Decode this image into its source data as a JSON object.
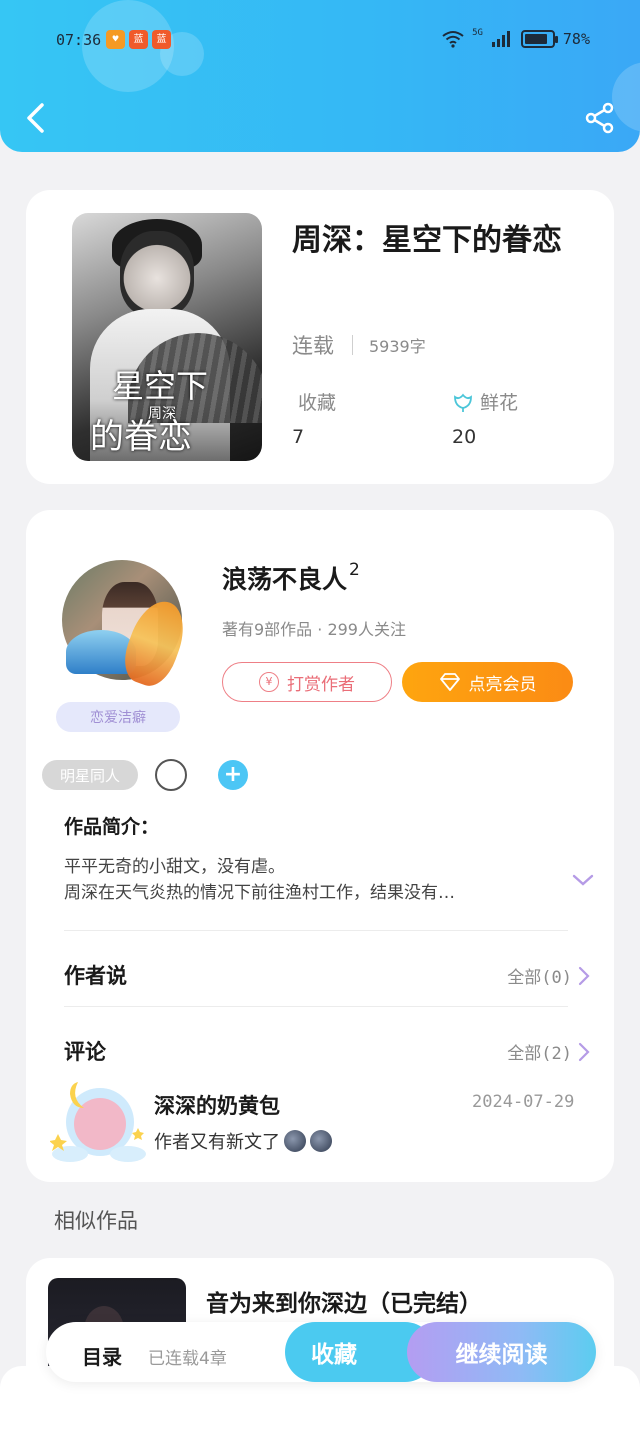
{
  "status_bar": {
    "time": "07:36",
    "apps": [
      "♥",
      "蓝",
      "蓝"
    ],
    "network": "5G",
    "battery": "78%"
  },
  "book": {
    "title": "周深：星空下的眷恋",
    "status": "连载",
    "word_count": "5939字",
    "cover_title_top": "星空下",
    "cover_title_bottom": "的眷恋",
    "cover_author_mark": "周深",
    "favorites_label": "收藏",
    "favorites_value": "7",
    "flowers_label": "鲜花",
    "flowers_value": "20"
  },
  "author": {
    "name": "浪荡不良人",
    "level": "2",
    "subtitle": "著有9部作品 · 299人关注",
    "badge": "恋爱洁癖",
    "tip_button": "打赏作者",
    "tip_icon": "¥",
    "vip_button": "点亮会员"
  },
  "tags": {
    "first": "明星同人",
    "add": "+"
  },
  "intro": {
    "heading": "作品简介：",
    "line1": "平平无奇的小甜文，没有虐。",
    "line2": "周深在天气炎热的情况下前往渔村工作，结果没有…"
  },
  "author_says": {
    "heading": "作者说",
    "more": "全部(0)"
  },
  "comments": {
    "heading": "评论",
    "more": "全部(2)",
    "items": [
      {
        "user": "深深的奶黄包",
        "date": "2024-07-29",
        "text": "作者又有新文了"
      }
    ]
  },
  "similar": {
    "heading": "相似作品",
    "items": [
      {
        "title": "音为来到你深边（已完结）"
      }
    ]
  },
  "action_bar": {
    "toc": "目录",
    "toc_sub": "已连载4章",
    "favorite": "收藏",
    "continue": "继续阅读"
  },
  "colors": {
    "header": "#36c6f4",
    "accent_blue": "#4bcaf0",
    "vip_orange": "#fb8b14",
    "tip_pink": "#ea6e78"
  },
  "icons": [
    "back-arrow-icon",
    "share-icon",
    "flower-icon",
    "diamond-icon",
    "chevron-right-icon",
    "chevron-down-icon",
    "wifi-icon",
    "signal-icon",
    "battery-icon"
  ]
}
